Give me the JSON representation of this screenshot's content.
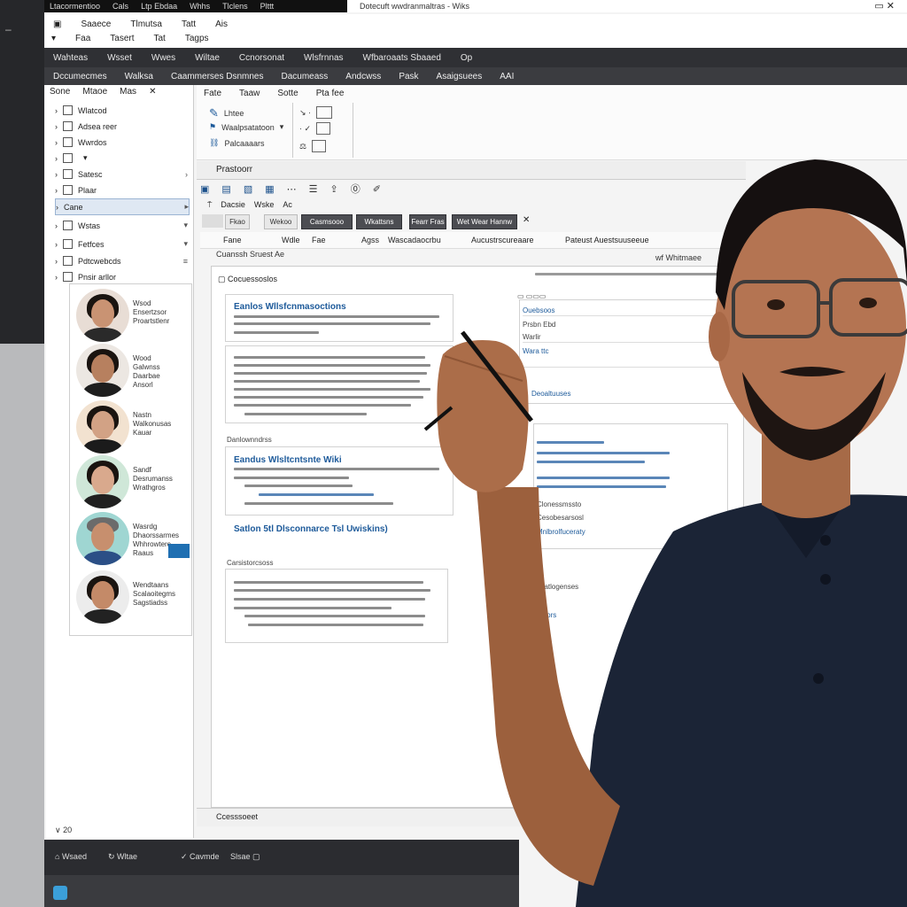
{
  "os_bar": {
    "items": [
      "Ltacormentioo",
      "Cals",
      "Ltp Ebdaa",
      "Whhs",
      "Tlclens",
      "Plttt"
    ]
  },
  "window": {
    "title": "Dotecuft wwdranmaltras - Wiks",
    "controls": "▭  ✕"
  },
  "menu": {
    "row1": [
      "Saaece",
      "Tlmutsa",
      "Tatt",
      "Ais"
    ],
    "row2": [
      "Faa",
      "Tasert",
      "Tat",
      "Tagps"
    ]
  },
  "band1": [
    "Wahteas",
    "Wsset",
    "Wwes",
    "Wiltae",
    "Ccnorsonat",
    "Wlsfrnnas",
    "Wfbaroaats Sbaaed",
    "Op"
  ],
  "band2": [
    "Dccumecmes",
    "Walksa",
    "Caammerses Dsnmnes",
    "Dacumeass",
    "Andcwss",
    "Pask",
    "Asaigsuees",
    "AAI"
  ],
  "nav": {
    "header": [
      "Sone",
      "Mtaoe",
      "Mas"
    ],
    "items": [
      {
        "label": "Wlatcod"
      },
      {
        "label": "Adsea reer"
      },
      {
        "label": "Wwrdos"
      },
      {
        "label": ""
      },
      {
        "label": "Satesc"
      },
      {
        "label": "Plaar"
      },
      {
        "label": "Cane"
      },
      {
        "label": "Wstas"
      },
      {
        "label": "Fetfces"
      },
      {
        "label": "Pdtcwebcds"
      },
      {
        "label": "Pnsir arllor"
      }
    ],
    "footer": "∨ 20"
  },
  "contacts": [
    {
      "name": "Wsod\nEnsertzsor\nProartstlenr"
    },
    {
      "name": "Wood\nGalwnss\nDaarbae\nAnsorl"
    },
    {
      "name": "Nastn\nWalkonusas\nKauar"
    },
    {
      "name": "Sandf\nDesrumanss\nWrathgros"
    },
    {
      "name": "Wasrdg\nDhaorssarmes\nWhhrowtere\nRaaus"
    },
    {
      "name": "Wendtaans\nScalaoitegms\nSagstiadss"
    }
  ],
  "ribbon": {
    "tabs": [
      "Fate",
      "Taaw",
      "Sotte",
      "Pta fee"
    ],
    "buttons": [
      "Lhtee",
      "Waalpsatatoon",
      "Palcaaaars"
    ]
  },
  "format": {
    "label": "Prastoorr"
  },
  "tabsrow": {
    "label1": "Dacsie",
    "label2": "Wske",
    "label3": "Ac",
    "pill_a": "Fkao",
    "pill_b": "Wekoo",
    "pill_c": "Casmsooo",
    "pill_d": "Wkattsns",
    "pill_e": "Fearr Fras",
    "pill_f": "Wet Wear Hannw"
  },
  "breadcrumb": [
    "Fane",
    "Wdle",
    "Fae",
    "Agss",
    "Wascadaocrbu",
    "Aucustrscureaare",
    "Pateust Auestsuuseeue"
  ],
  "doc": {
    "header": "Cuanssh Sruest Ae",
    "right_tag": "wf Whitmaee",
    "section_label": "Cocuessoslos",
    "title1": "Eanlos Wllsfcnmasoctions",
    "title2": "Eandus Wlsltcntsnte Wiki",
    "title3": "Satlon 5tl Dlsconnarce Tsl Uwiskins)",
    "sub1": "Danlownndrss",
    "sub2": "Carsistorcsoss",
    "right_list": [
      "Ouebsoos",
      "Prsbn Ebd",
      "Warlir",
      "Wara ttc",
      "Deoaltuuses"
    ],
    "right_list2": [
      "Clonessmssto",
      "Cesobesarsosl",
      "Mnlbrolfuceraty",
      "Caalatlogenses",
      "Caarlors"
    ]
  },
  "statusbar": "Ccesssoeet",
  "bottom": {
    "item1": "Wsaed",
    "item2": "Wltae",
    "item3": "Cavmde",
    "item4": "Slsae"
  },
  "colors": {
    "accent": "#1d5a9a",
    "dark_band": "#2f3034",
    "shirt": "#1b2436"
  }
}
